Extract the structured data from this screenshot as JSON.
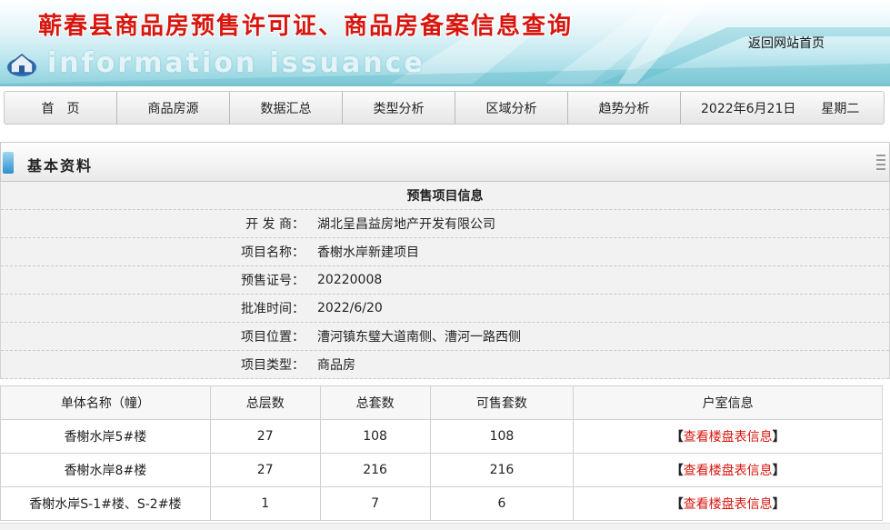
{
  "banner": {
    "title": "蕲春县商品房预售许可证、商品房备案信息查询",
    "subtitle": "information issuance",
    "home_link": "返回网站首页"
  },
  "nav": {
    "items": [
      "首　页",
      "商品房源",
      "数据汇总",
      "类型分析",
      "区域分析",
      "趋势分析"
    ],
    "date": "2022年6月21日",
    "weekday": "星期二"
  },
  "section": {
    "title": "基本资料"
  },
  "project": {
    "header": "预售项目信息",
    "rows": [
      {
        "label": "开 发 商：",
        "value": "湖北呈昌益房地产开发有限公司"
      },
      {
        "label": "项目名称：",
        "value": "香榭水岸新建项目"
      },
      {
        "label": "预售证号：",
        "value": "20220008"
      },
      {
        "label": "批准时间：",
        "value": "2022/6/20"
      },
      {
        "label": "项目位置：",
        "value": "漕河镇东璧大道南侧、漕河一路西侧"
      },
      {
        "label": "项目类型：",
        "value": "商品房"
      }
    ]
  },
  "units": {
    "columns": [
      "单体名称（幢）",
      "总层数",
      "总套数",
      "可售套数",
      "户室信息"
    ],
    "rows": [
      {
        "name": "香榭水岸5#楼",
        "floors": "27",
        "total": "108",
        "available": "108",
        "link": "查看楼盘表信息"
      },
      {
        "name": "香榭水岸8#楼",
        "floors": "27",
        "total": "216",
        "available": "216",
        "link": "查看楼盘表信息"
      },
      {
        "name": "香榭水岸S-1#楼、S-2#楼",
        "floors": "1",
        "total": "7",
        "available": "6",
        "link": "查看楼盘表信息"
      }
    ],
    "bracket_open": "【",
    "bracket_close": "】"
  },
  "colors": {
    "title_red": "#d7160e",
    "banner_teal": "#79c2cf",
    "link_red": "#d7160e"
  }
}
